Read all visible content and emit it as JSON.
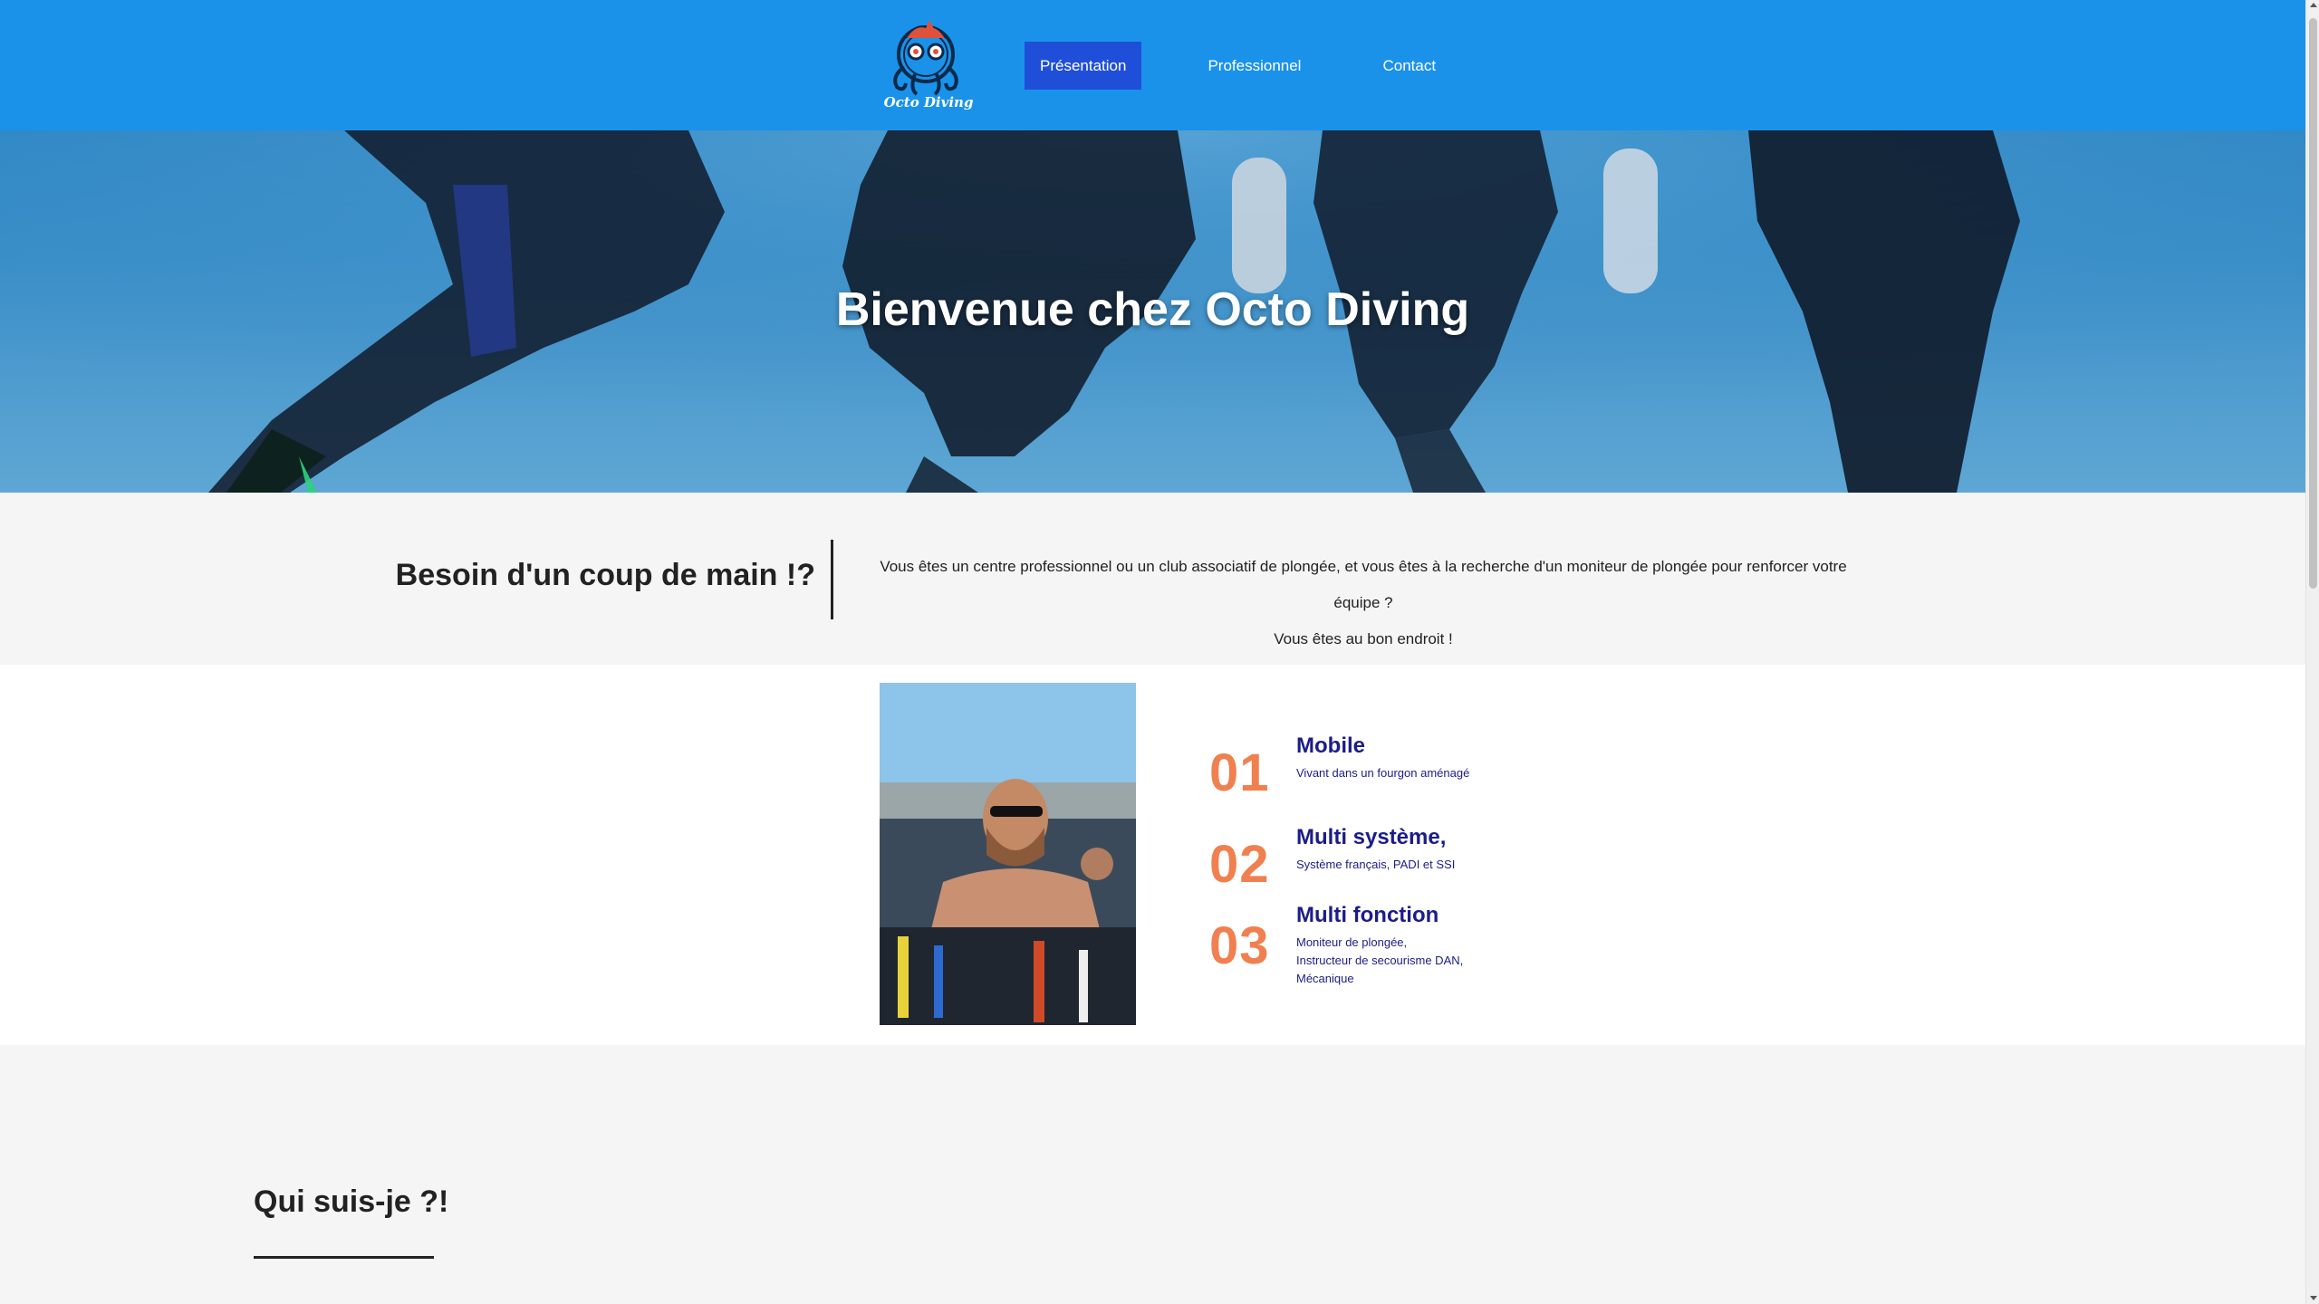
{
  "header": {
    "logo_text": "Octo Diving",
    "nav": [
      {
        "label": "Présentation",
        "active": true
      },
      {
        "label": "Professionnel",
        "active": false
      },
      {
        "label": "Contact",
        "active": false
      }
    ],
    "background_color": "#1a92ea",
    "active_color": "#1f4fd8"
  },
  "hero": {
    "title": "Bienvenue chez Octo Diving"
  },
  "help": {
    "title": "Besoin d'un coup de main !?",
    "line1": "Vous êtes un centre professionnel ou un club associatif de plongée, et vous êtes à la recherche d'un moniteur de plongée pour renforcer votre équipe ?",
    "line2": "Vous êtes au bon endroit !"
  },
  "features": [
    {
      "number": "01",
      "title": "Mobile",
      "desc": [
        "Vivant dans un fourgon aménagé"
      ]
    },
    {
      "number": "02",
      "title": "Multi système,",
      "desc": [
        "Système français, PADI et SSI"
      ]
    },
    {
      "number": "03",
      "title": "Multi fonction",
      "desc": [
        "Moniteur de plongée,",
        "Instructeur de secourisme DAN,",
        "Mécanique"
      ]
    }
  ],
  "about": {
    "title": "Qui suis-je ?!"
  },
  "colors": {
    "accent_number": "#f08050",
    "feature_text": "#1c1c8a"
  }
}
